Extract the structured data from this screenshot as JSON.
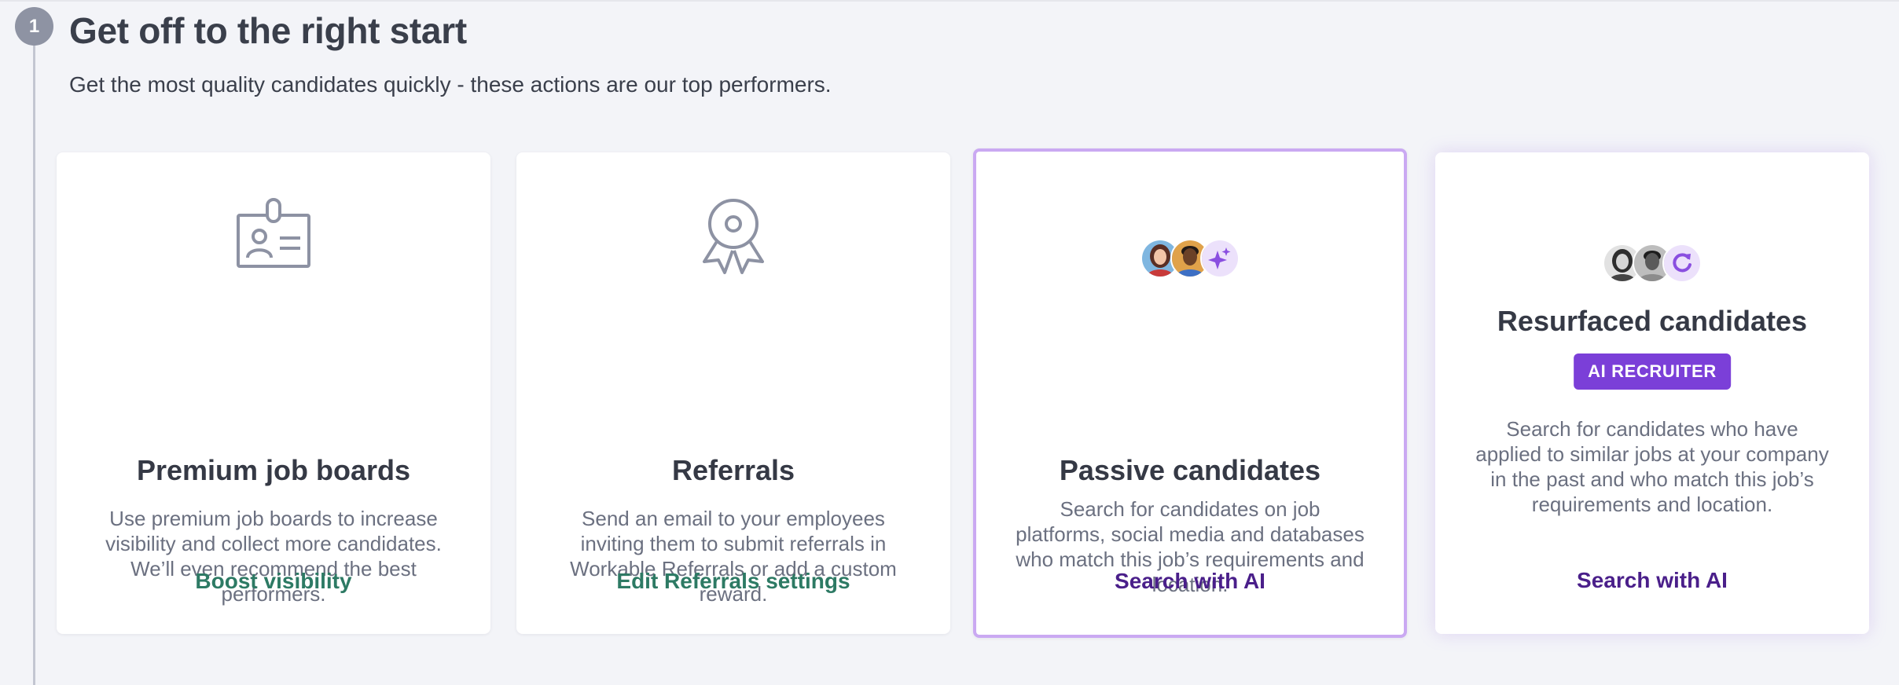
{
  "step": {
    "number": "1",
    "title": "Get off to the right start",
    "subtitle": "Get the most quality candidates quickly - these actions are our top performers."
  },
  "cards": [
    {
      "icon": "id-badge-icon",
      "title": "Premium job boards",
      "description": "Use premium job boards to increase visibility and collect more candidates. We’ll even recommend the best performers.",
      "action": "Boost visibility"
    },
    {
      "icon": "award-ribbon-icon",
      "title": "Referrals",
      "description": "Send an email to your employees inviting them to submit referrals in Workable Referrals or add a custom reward.",
      "action": "Edit Referrals settings"
    },
    {
      "icon": "candidate-avatars-sparkle-icon",
      "title": "Passive candidates",
      "description": "Search for candidates on job platforms, social media and databases who match this job’s requirements and location.",
      "action": "Search with AI"
    },
    {
      "icon": "candidate-avatars-refresh-icon",
      "title": "Resurfaced candidates",
      "badge": "AI RECRUITER",
      "description": "Search for candidates who have applied to similar jobs at your company in the past and who match this job’s requirements and location.",
      "action": "Search with AI"
    }
  ],
  "colors": {
    "action_green": "#2d7a64",
    "action_purple": "#4a1f8a",
    "badge_purple": "#7b3fd8",
    "highlight_border": "#caa9f2"
  }
}
